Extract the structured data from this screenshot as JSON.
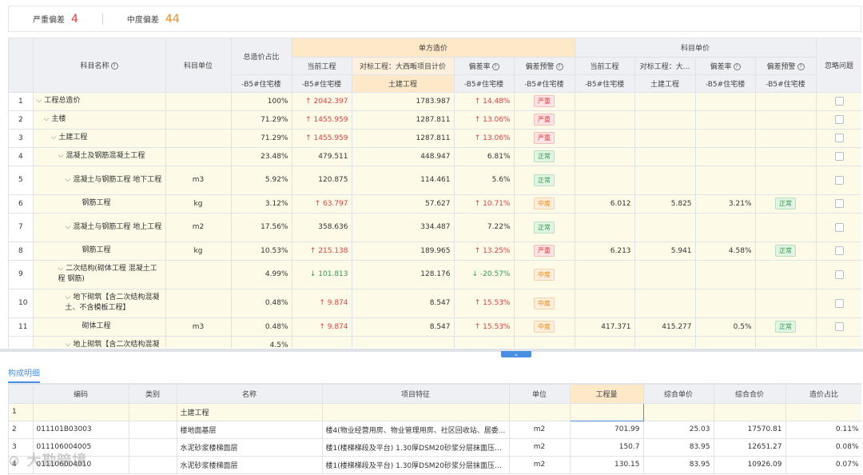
{
  "summary": {
    "severe_label": "严重偏差",
    "severe_count": "4",
    "moderate_label": "中度偏差",
    "moderate_count": "44"
  },
  "main_table": {
    "headers": {
      "name": "科目名称",
      "unit": "科目单位",
      "cost_ratio": "总造价占比",
      "cost_ratio_sub": "-B5#住宅楼",
      "unit_price_group": "单方造价",
      "current": "当前工程",
      "current_sub": "-B5#住宅楼",
      "benchmark": "对标工程：大西畈项目计价",
      "benchmark_sub": "土建工程",
      "dev_rate": "偏差率",
      "dev_rate_sub": "-B5#住宅楼",
      "dev_warn": "偏差预警",
      "dev_warn_sub": "-B5#住宅楼",
      "item_price_group": "科目单价",
      "item_current": "当前工程",
      "item_current_sub": "-B5#住宅楼",
      "item_benchmark": "对标工程：大...",
      "item_benchmark_sub": "土建工程",
      "item_dev_rate": "偏差率",
      "item_dev_rate_sub": "-B5#住宅楼",
      "item_dev_warn": "偏差预警",
      "item_dev_warn_sub": "-B5#住宅楼",
      "ignore": "忽略问题"
    },
    "rows": [
      {
        "idx": "1",
        "name": "工程总造价",
        "level": 0,
        "unit": "",
        "ratio": "100%",
        "current": "2042.397",
        "cur_dir": "up",
        "bench": "1783.987",
        "rate": "14.48%",
        "rate_dir": "up",
        "warn": "严重",
        "warn_type": "sev",
        "icur": "",
        "ibench": "",
        "irate": "",
        "iwarn": "",
        "iwarn_type": ""
      },
      {
        "idx": "2",
        "name": "主楼",
        "level": 1,
        "unit": "",
        "ratio": "71.29%",
        "current": "1455.959",
        "cur_dir": "up",
        "bench": "1287.811",
        "rate": "13.06%",
        "rate_dir": "up",
        "warn": "严重",
        "warn_type": "sev",
        "icur": "",
        "ibench": "",
        "irate": "",
        "iwarn": "",
        "iwarn_type": ""
      },
      {
        "idx": "3",
        "name": "土建工程",
        "level": 2,
        "unit": "",
        "ratio": "71.29%",
        "current": "1455.959",
        "cur_dir": "up",
        "bench": "1287.811",
        "rate": "13.06%",
        "rate_dir": "up",
        "warn": "严重",
        "warn_type": "sev",
        "icur": "",
        "ibench": "",
        "irate": "",
        "iwarn": "",
        "iwarn_type": ""
      },
      {
        "idx": "4",
        "name": "混凝土及钢筋混凝土工程",
        "level": 3,
        "unit": "",
        "ratio": "23.48%",
        "current": "479.511",
        "cur_dir": "",
        "bench": "448.947",
        "rate": "6.81%",
        "rate_dir": "",
        "warn": "正常",
        "warn_type": "ok",
        "icur": "",
        "ibench": "",
        "irate": "",
        "iwarn": "",
        "iwarn_type": ""
      },
      {
        "idx": "5",
        "name": "混凝土与钢筋工程 地下工程",
        "level": 4,
        "unit": "m3",
        "ratio": "5.92%",
        "current": "120.875",
        "cur_dir": "",
        "bench": "114.461",
        "rate": "5.6%",
        "rate_dir": "",
        "warn": "正常",
        "warn_type": "ok",
        "icur": "",
        "ibench": "",
        "irate": "",
        "iwarn": "",
        "iwarn_type": ""
      },
      {
        "idx": "6",
        "name": "钢筋工程",
        "level": 5,
        "unit": "kg",
        "ratio": "3.12%",
        "current": "63.797",
        "cur_dir": "up",
        "bench": "57.627",
        "rate": "10.71%",
        "rate_dir": "up",
        "warn": "中度",
        "warn_type": "mid",
        "icur": "6.012",
        "ibench": "5.825",
        "irate": "3.21%",
        "iwarn": "正常",
        "iwarn_type": "ok"
      },
      {
        "idx": "7",
        "name": "混凝土与钢筋工程 地上工程",
        "level": 4,
        "unit": "m2",
        "ratio": "17.56%",
        "current": "358.636",
        "cur_dir": "",
        "bench": "334.487",
        "rate": "7.22%",
        "rate_dir": "",
        "warn": "正常",
        "warn_type": "ok",
        "icur": "",
        "ibench": "",
        "irate": "",
        "iwarn": "",
        "iwarn_type": ""
      },
      {
        "idx": "8",
        "name": "钢筋工程",
        "level": 5,
        "unit": "kg",
        "ratio": "10.53%",
        "current": "215.138",
        "cur_dir": "up",
        "bench": "189.965",
        "rate": "13.25%",
        "rate_dir": "up",
        "warn": "严重",
        "warn_type": "sev",
        "icur": "6.213",
        "ibench": "5.941",
        "irate": "4.58%",
        "iwarn": "正常",
        "iwarn_type": "ok"
      },
      {
        "idx": "9",
        "name": "二次结构(砌体工程 混凝土工程 钢筋)",
        "level": 3,
        "unit": "",
        "ratio": "4.99%",
        "current": "101.813",
        "cur_dir": "down",
        "bench": "128.176",
        "rate": "-20.57%",
        "rate_dir": "down",
        "warn": "中度",
        "warn_type": "mid",
        "icur": "",
        "ibench": "",
        "irate": "",
        "iwarn": "",
        "iwarn_type": ""
      },
      {
        "idx": "10",
        "name": "地下砌筑【含二次结构混凝土、不含模板工程】",
        "level": 4,
        "unit": "",
        "ratio": "0.48%",
        "current": "9.874",
        "cur_dir": "up",
        "bench": "8.547",
        "rate": "15.53%",
        "rate_dir": "up",
        "warn": "中度",
        "warn_type": "mid",
        "icur": "",
        "ibench": "",
        "irate": "",
        "iwarn": "",
        "iwarn_type": ""
      },
      {
        "idx": "11",
        "name": "砌体工程",
        "level": 5,
        "unit": "m3",
        "ratio": "0.48%",
        "current": "9.874",
        "cur_dir": "up",
        "bench": "8.547",
        "rate": "15.53%",
        "rate_dir": "up",
        "warn": "中度",
        "warn_type": "mid",
        "icur": "417.371",
        "ibench": "415.277",
        "irate": "0.5%",
        "iwarn": "正常",
        "iwarn_type": "ok"
      },
      {
        "idx": "",
        "name": "地上砌筑【含二次结构混凝",
        "level": 4,
        "unit": "",
        "ratio": "4.5%",
        "current": "",
        "cur_dir": "",
        "bench": "",
        "rate": "",
        "rate_dir": "",
        "warn": "",
        "warn_type": "",
        "icur": "",
        "ibench": "",
        "irate": "",
        "iwarn": "",
        "iwarn_type": ""
      }
    ]
  },
  "detail": {
    "tab_label": "构成明细",
    "headers": [
      "",
      "编码",
      "类别",
      "名称",
      "项目特征",
      "单位",
      "工程量",
      "综合单价",
      "综合合价",
      "造价占比"
    ],
    "rows": [
      {
        "idx": "1",
        "code": "",
        "cat": "",
        "name": "土建工程",
        "feature": "",
        "unit": "",
        "qty": "",
        "price": "",
        "total": "",
        "ratio": ""
      },
      {
        "idx": "2",
        "code": "011101B03003",
        "cat": "",
        "name": "楼地面基层",
        "feature": "楼4(物业经营用房、物业管理用房、社区回收站、居委...",
        "unit": "m2",
        "qty": "701.99",
        "price": "25.03",
        "total": "17570.81",
        "ratio": "0.11%"
      },
      {
        "idx": "3",
        "code": "011106004005",
        "cat": "",
        "name": "水泥砂浆楼梯面层",
        "feature": "楼1(楼梯梯段及平台) 1.30厚DSM20砂浆分层抹面压光...",
        "unit": "m2",
        "qty": "150.7",
        "price": "83.95",
        "total": "12651.27",
        "ratio": "0.08%"
      },
      {
        "idx": "4",
        "code": "011106004010",
        "cat": "",
        "name": "水泥砂浆楼梯面层",
        "feature": "楼1(楼梯梯段及平台) 1.30厚DSM20砂浆分层抹面压光...",
        "unit": "m2",
        "qty": "130.15",
        "price": "83.95",
        "total": "10926.09",
        "ratio": "0.07%"
      }
    ]
  },
  "watermark": "大勘暗境"
}
